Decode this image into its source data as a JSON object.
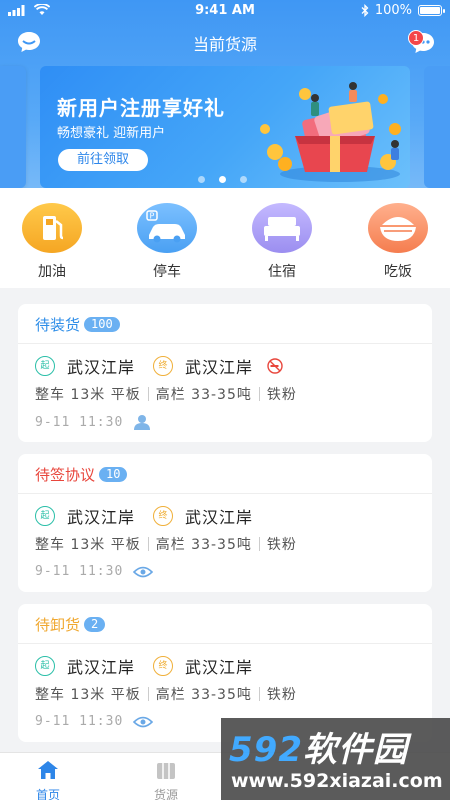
{
  "status_bar": {
    "time": "9:41 AM",
    "battery": "100%"
  },
  "nav": {
    "title": "当前货源",
    "message_badge": "1"
  },
  "banner": {
    "title": "新用户注册享好礼",
    "subtitle": "畅想豪礼 迎新用户",
    "button_label": "前往领取",
    "slides": 3,
    "active_slide": 2
  },
  "services": [
    {
      "label": "加油",
      "icon": "fuel-icon",
      "color": "#f5a623"
    },
    {
      "label": "停车",
      "icon": "car-icon",
      "color": "#4aa0f3"
    },
    {
      "label": "住宿",
      "icon": "bed-icon",
      "color": "#9b8ef0"
    },
    {
      "label": "吃饭",
      "icon": "rice-bowl-icon",
      "color": "#f57d4f"
    }
  ],
  "cards": [
    {
      "status": "待装货",
      "status_color": "#2f8ee8",
      "count": "100",
      "start_tag": "起",
      "origin": "武汉江岸",
      "end_tag": "终",
      "destination": "武汉江岸",
      "vehicle": "整车 13米 平板",
      "rail": "高栏 33-35吨",
      "cargo": "铁粉",
      "time": "9-11 11:30",
      "meta_icon": "person-icon",
      "no_smoking": true
    },
    {
      "status": "待签协议",
      "status_color": "#e8463c",
      "count": "10",
      "start_tag": "起",
      "origin": "武汉江岸",
      "end_tag": "终",
      "destination": "武汉江岸",
      "vehicle": "整车 13米 平板",
      "rail": "高栏 33-35吨",
      "cargo": "铁粉",
      "time": "9-11 11:30",
      "meta_icon": "eye-icon"
    },
    {
      "status": "待卸货",
      "status_color": "#f0a830",
      "count": "2",
      "start_tag": "起",
      "origin": "武汉江岸",
      "end_tag": "终",
      "destination": "武汉江岸",
      "vehicle": "整车 13米 平板",
      "rail": "高栏 33-35吨",
      "cargo": "铁粉",
      "time": "9-11 11:30",
      "meta_icon": "eye-icon"
    }
  ],
  "tabbar": [
    {
      "label": "首页",
      "icon": "home-icon",
      "active": true
    },
    {
      "label": "货源",
      "icon": "cargo-icon",
      "active": false
    }
  ],
  "watermark": {
    "brand_num": "592",
    "brand_text": "软件园",
    "url": "www.592xiazai.com"
  },
  "colors": {
    "primary": "#3f97f4",
    "background": "#f2f3f5"
  }
}
